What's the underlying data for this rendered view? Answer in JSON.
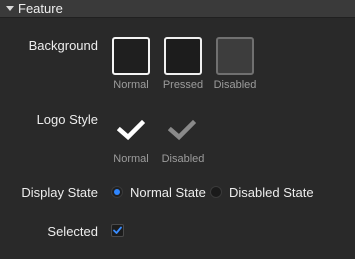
{
  "section": {
    "title": "Feature"
  },
  "background": {
    "label": "Background",
    "options": [
      {
        "caption": "Normal"
      },
      {
        "caption": "Pressed"
      },
      {
        "caption": "Disabled"
      }
    ]
  },
  "logo_style": {
    "label": "Logo Style",
    "options": [
      {
        "caption": "Normal",
        "icon": "checkmark-icon",
        "color": "#ffffff"
      },
      {
        "caption": "Disabled",
        "icon": "checkmark-icon",
        "color": "#8a8a8a"
      }
    ]
  },
  "display_state": {
    "label": "Display State",
    "options": [
      {
        "label": "Normal State",
        "selected": true
      },
      {
        "label": "Disabled State",
        "selected": false
      }
    ],
    "accent": "#2f86ff"
  },
  "selected": {
    "label": "Selected",
    "checked": true
  }
}
